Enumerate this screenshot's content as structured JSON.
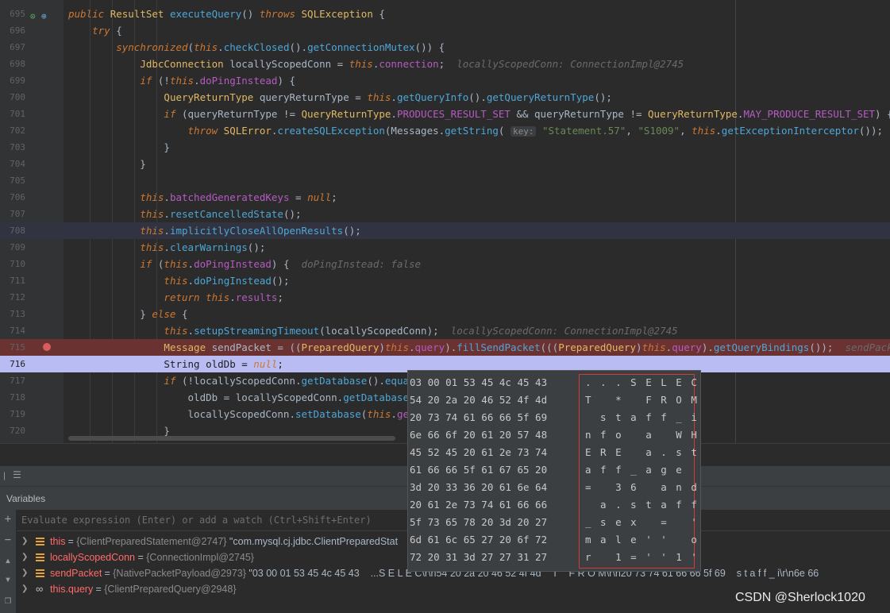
{
  "editor": {
    "lines": [
      {
        "num": "695",
        "segs": [
          [
            "kw",
            "public "
          ],
          [
            "ty",
            "ResultSet "
          ],
          [
            "fn",
            "executeQuery"
          ],
          [
            "",
            "() "
          ],
          [
            "kw",
            "throws "
          ],
          [
            "ty",
            "SQLException "
          ],
          [
            "",
            "{"
          ]
        ]
      },
      {
        "num": "696",
        "segs": [
          [
            "",
            "    "
          ],
          [
            "kw",
            "try "
          ],
          [
            "",
            "{"
          ]
        ]
      },
      {
        "num": "697",
        "segs": [
          [
            "",
            "        "
          ],
          [
            "kw",
            "synchronized"
          ],
          [
            "",
            "("
          ],
          [
            "kw",
            "this"
          ],
          [
            "",
            "."
          ],
          [
            "fn",
            "checkClosed"
          ],
          [
            "",
            "()."
          ],
          [
            "fn",
            "getConnectionMutex"
          ],
          [
            "",
            "()) {"
          ]
        ]
      },
      {
        "num": "698",
        "segs": [
          [
            "",
            "            "
          ],
          [
            "ty",
            "JdbcConnection "
          ],
          [
            "",
            "locallyScopedConn = "
          ],
          [
            "kw",
            "this"
          ],
          [
            "",
            "."
          ],
          [
            "fld",
            "connection"
          ],
          [
            "",
            ";  "
          ],
          [
            "hint",
            "locallyScopedConn: ConnectionImpl@2745"
          ]
        ]
      },
      {
        "num": "699",
        "segs": [
          [
            "",
            "            "
          ],
          [
            "kw",
            "if "
          ],
          [
            "",
            "(!"
          ],
          [
            "kw",
            "this"
          ],
          [
            "",
            "."
          ],
          [
            "fld",
            "doPingInstead"
          ],
          [
            "",
            ") {"
          ]
        ]
      },
      {
        "num": "700",
        "segs": [
          [
            "",
            "                "
          ],
          [
            "ty",
            "QueryReturnType "
          ],
          [
            "",
            "queryReturnType = "
          ],
          [
            "kw",
            "this"
          ],
          [
            "",
            "."
          ],
          [
            "fn",
            "getQueryInfo"
          ],
          [
            "",
            "()."
          ],
          [
            "fn",
            "getQueryReturnType"
          ],
          [
            "",
            "();"
          ]
        ]
      },
      {
        "num": "701",
        "segs": [
          [
            "",
            "                "
          ],
          [
            "kw",
            "if "
          ],
          [
            "",
            "(queryReturnType != "
          ],
          [
            "ty",
            "QueryReturnType"
          ],
          [
            "",
            "."
          ],
          [
            "fld",
            "PRODUCES_RESULT_SET "
          ],
          [
            "",
            "&& queryReturnType != "
          ],
          [
            "ty",
            "QueryReturnType"
          ],
          [
            "",
            "."
          ],
          [
            "fld",
            "MAY_PRODUCE_RESULT_SET"
          ],
          [
            "",
            ") {"
          ]
        ]
      },
      {
        "num": "702",
        "segs": [
          [
            "",
            "                    "
          ],
          [
            "kw",
            "throw "
          ],
          [
            "ty",
            "SQLError"
          ],
          [
            "",
            "."
          ],
          [
            "fn",
            "createSQLException"
          ],
          [
            "",
            "(Messages."
          ],
          [
            "fn",
            "getString"
          ],
          [
            "",
            "( "
          ],
          [
            "param",
            "key:"
          ],
          [
            "str",
            " \"Statement.57\""
          ],
          [
            "",
            ", "
          ],
          [
            "str",
            "\"S1009\""
          ],
          [
            "",
            ", "
          ],
          [
            "kw",
            "this"
          ],
          [
            "",
            "."
          ],
          [
            "fn",
            "getExceptionInterceptor"
          ],
          [
            "",
            "());"
          ]
        ]
      },
      {
        "num": "703",
        "segs": [
          [
            "",
            "                }"
          ]
        ]
      },
      {
        "num": "704",
        "segs": [
          [
            "",
            "            }"
          ]
        ]
      },
      {
        "num": "705",
        "segs": [
          [
            "",
            ""
          ]
        ]
      },
      {
        "num": "706",
        "segs": [
          [
            "",
            "            "
          ],
          [
            "kw",
            "this"
          ],
          [
            "",
            "."
          ],
          [
            "fld",
            "batchedGeneratedKeys "
          ],
          [
            "",
            "= "
          ],
          [
            "kw",
            "null"
          ],
          [
            "",
            ";"
          ]
        ]
      },
      {
        "num": "707",
        "segs": [
          [
            "",
            "            "
          ],
          [
            "kw",
            "this"
          ],
          [
            "",
            "."
          ],
          [
            "fn",
            "resetCancelledState"
          ],
          [
            "",
            "();"
          ]
        ]
      },
      {
        "num": "708",
        "segs": [
          [
            "",
            "            "
          ],
          [
            "kw",
            "this"
          ],
          [
            "",
            "."
          ],
          [
            "fn",
            "implicitlyCloseAllOpenResults"
          ],
          [
            "",
            "();"
          ]
        ]
      },
      {
        "num": "709",
        "segs": [
          [
            "",
            "            "
          ],
          [
            "kw",
            "this"
          ],
          [
            "",
            "."
          ],
          [
            "fn",
            "clearWarnings"
          ],
          [
            "",
            "();"
          ]
        ]
      },
      {
        "num": "710",
        "segs": [
          [
            "",
            "            "
          ],
          [
            "kw",
            "if "
          ],
          [
            "",
            "("
          ],
          [
            "kw",
            "this"
          ],
          [
            "",
            "."
          ],
          [
            "fld",
            "doPingInstead"
          ],
          [
            "",
            ") {  "
          ],
          [
            "hint",
            "doPingInstead: false"
          ]
        ]
      },
      {
        "num": "711",
        "segs": [
          [
            "",
            "                "
          ],
          [
            "kw",
            "this"
          ],
          [
            "",
            "."
          ],
          [
            "fn",
            "doPingInstead"
          ],
          [
            "",
            "();"
          ]
        ]
      },
      {
        "num": "712",
        "segs": [
          [
            "",
            "                "
          ],
          [
            "kw",
            "return "
          ],
          [
            "kw",
            "this"
          ],
          [
            "",
            "."
          ],
          [
            "fld",
            "results"
          ],
          [
            "",
            ";"
          ]
        ]
      },
      {
        "num": "713",
        "segs": [
          [
            "",
            "            } "
          ],
          [
            "kw",
            "else "
          ],
          [
            "",
            "{"
          ]
        ]
      },
      {
        "num": "714",
        "segs": [
          [
            "",
            "                "
          ],
          [
            "kw",
            "this"
          ],
          [
            "",
            "."
          ],
          [
            "fn",
            "setupStreamingTimeout"
          ],
          [
            "",
            "(locallyScopedConn);  "
          ],
          [
            "hint",
            "locallyScopedConn: ConnectionImpl@2745"
          ]
        ]
      },
      {
        "num": "715",
        "segs": [
          [
            "",
            "                "
          ],
          [
            "ty",
            "Message "
          ],
          [
            "",
            "sendPacket = (("
          ],
          [
            "ty",
            "PreparedQuery"
          ],
          [
            "",
            ")"
          ],
          [
            "kw",
            "this"
          ],
          [
            "",
            "."
          ],
          [
            "fld",
            "query"
          ],
          [
            "",
            ")."
          ],
          [
            "fn",
            "fillSendPacket"
          ],
          [
            "",
            "((("
          ],
          [
            "ty",
            "PreparedQuery"
          ],
          [
            "",
            ")"
          ],
          [
            "kw",
            "this"
          ],
          [
            "",
            "."
          ],
          [
            "fld",
            "query"
          ],
          [
            "",
            ")."
          ],
          [
            "fn",
            "getQueryBindings"
          ],
          [
            "",
            "());  "
          ],
          [
            "hint",
            "sendPacket: \"("
          ]
        ]
      },
      {
        "num": "716",
        "segs": [
          [
            "",
            "                String oldDb = "
          ],
          [
            "kw",
            "null"
          ],
          [
            "",
            ";"
          ]
        ]
      },
      {
        "num": "717",
        "segs": [
          [
            "",
            "                "
          ],
          [
            "kw",
            "if "
          ],
          [
            "",
            "(!locallyScopedConn."
          ],
          [
            "fn",
            "getDatabase"
          ],
          [
            "",
            "()."
          ],
          [
            "fn",
            "equa"
          ]
        ]
      },
      {
        "num": "718",
        "segs": [
          [
            "",
            "                    oldDb = locallyScopedConn."
          ],
          [
            "fn",
            "getDatabase"
          ]
        ]
      },
      {
        "num": "719",
        "segs": [
          [
            "",
            "                    locallyScopedConn."
          ],
          [
            "fn",
            "setDatabase"
          ],
          [
            "",
            "("
          ],
          [
            "kw",
            "this"
          ],
          [
            "",
            "."
          ],
          [
            "fld",
            "ge"
          ]
        ]
      },
      {
        "num": "720",
        "segs": [
          [
            "",
            "                }"
          ]
        ]
      }
    ]
  },
  "hex_popup": {
    "hex_rows": [
      "03 00 01 53 45 4c 45 43",
      "54 20 2a 20 46 52 4f 4d",
      "20 73 74 61 66 66 5f 69",
      "6e 66 6f 20 61 20 57 48",
      "45 52 45 20 61 2e 73 74",
      "61 66 66 5f 61 67 65 20",
      "3d 20 33 36 20 61 6e 64",
      "20 61 2e 73 74 61 66 66",
      "5f 73 65 78 20 3d 20 27",
      "6d 61 6c 65 27 20 6f 72",
      "72 20 31 3d 27 27 31 27"
    ],
    "ascii_rows": [
      ". . . S E L E C",
      "T   *   F R O M",
      "  s t a f f _ i",
      "n f o   a   W H",
      "E R E   a . s t",
      "a f f _ a g e",
      "=   3 6   a n d",
      "  a . s t a f f",
      "_ s e x   =   '",
      "m a l e ' '   o",
      "r   1 = ' ' 1 '"
    ],
    "accent": "#d03b3b"
  },
  "panel": {
    "title": "Variables",
    "eval_placeholder": "Evaluate expression (Enter) or add a watch (Ctrl+Shift+Enter)",
    "vars": [
      {
        "name": "this",
        "type": "{ClientPreparedStatement@2747}",
        "value": " \"com.mysql.cj.jdbc.ClientPreparedStat",
        "icon": "field-icon"
      },
      {
        "name": "locallyScopedConn",
        "type": "{ConnectionImpl@2745}",
        "value": "",
        "icon": "field-icon"
      },
      {
        "name": "sendPacket",
        "type": "{NativePacketPayload@2973}",
        "value": " \"03 00 01 53 45 4c 45 43    ...S E L E C\\r\\n54 20 2a 20 46 52 4f 4d    T    F R O M\\r\\n20 73 74 61 66 66 5f 69    s t a f f _ i\\r\\n6e 66",
        "icon": "field-icon"
      },
      {
        "name": "this.query",
        "type": "{ClientPreparedQuery@2948}",
        "value": "",
        "icon": "watch-icon"
      }
    ]
  },
  "watermark": "CSDN @Sherlock1020"
}
